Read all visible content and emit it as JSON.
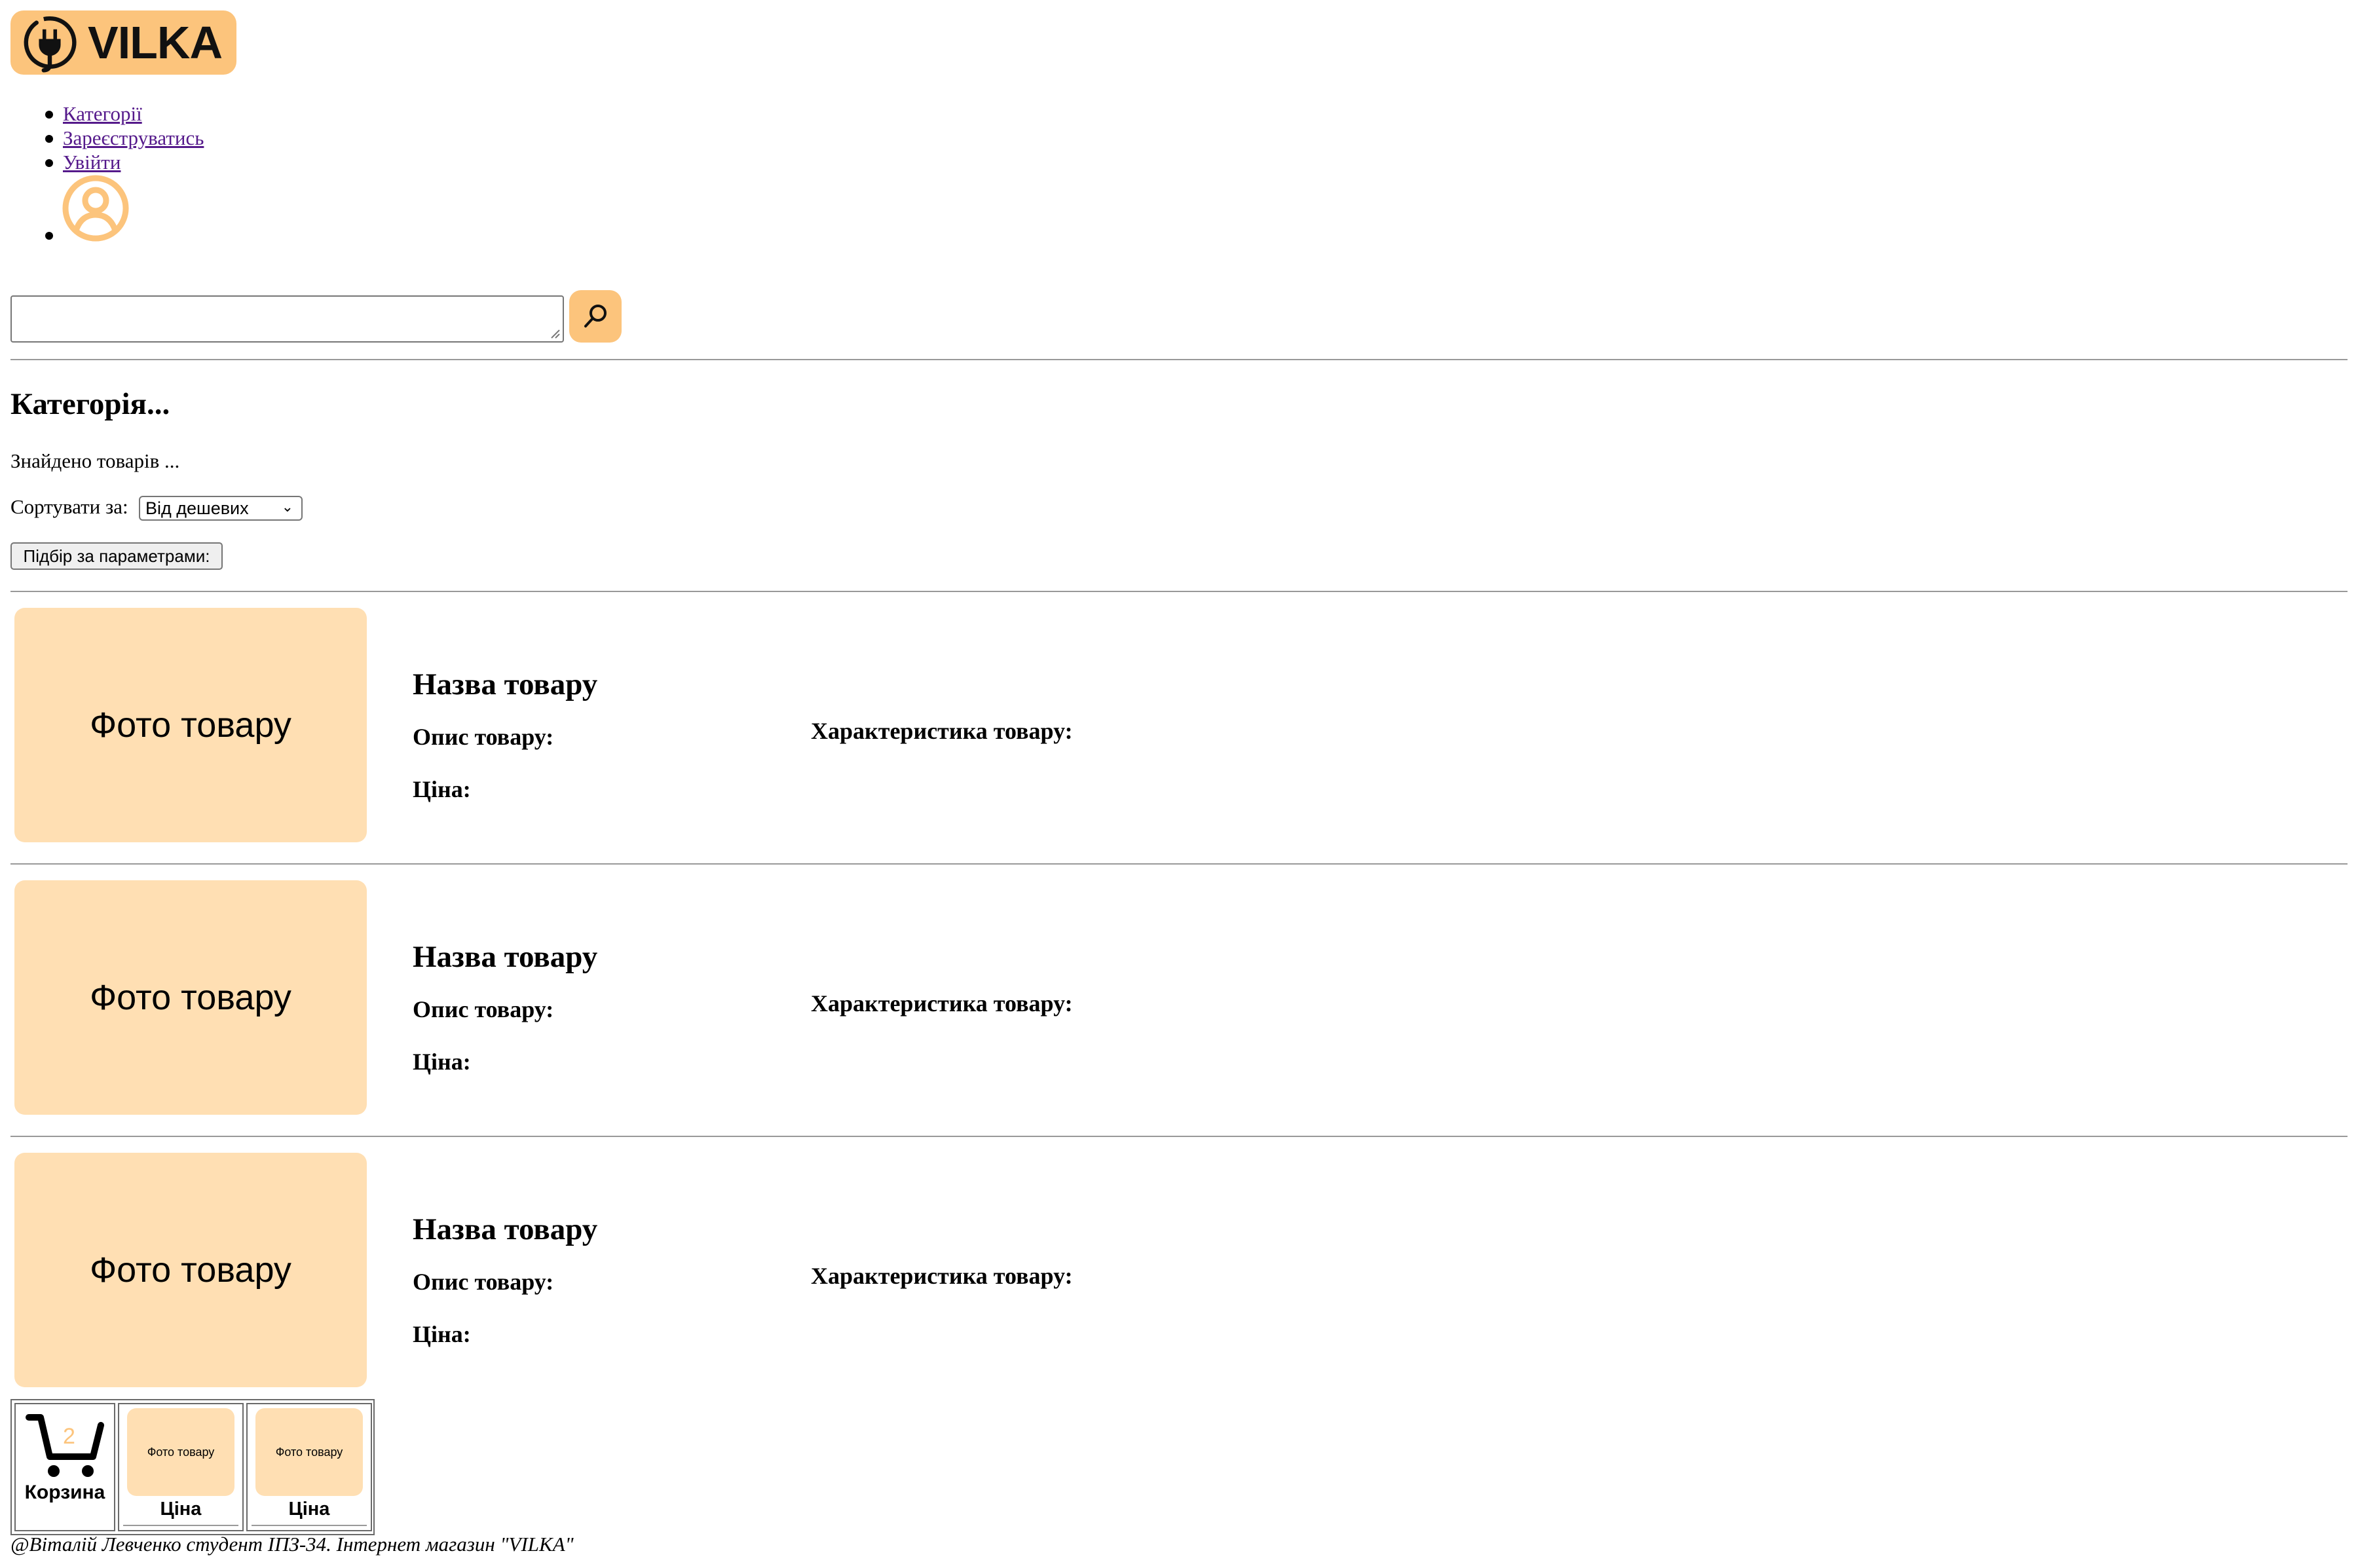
{
  "logo": {
    "text": "VILKA",
    "icon": "plug-icon"
  },
  "nav": {
    "items": [
      {
        "label": "Категорії"
      },
      {
        "label": "Зареєструватись"
      },
      {
        "label": "Увійти"
      }
    ],
    "account_icon": "user-circle-icon"
  },
  "search": {
    "value": "",
    "button_icon": "search-icon"
  },
  "category": {
    "title": "Категорія...",
    "found_text": "Знайдено товарів ...",
    "sort_label": "Сортувати за:",
    "sort_selected": "Від дешевих",
    "filter_button": "Підбір за параметрами:"
  },
  "products": [
    {
      "photo": "Фото товару",
      "name": "Назва товару",
      "desc_label": "Опис товару:",
      "spec_label": "Характеристика товару:",
      "price_label": "Ціна:"
    },
    {
      "photo": "Фото товару",
      "name": "Назва товару",
      "desc_label": "Опис товару:",
      "spec_label": "Характеристика товару:",
      "price_label": "Ціна:"
    },
    {
      "photo": "Фото товару",
      "name": "Назва товару",
      "desc_label": "Опис товару:",
      "spec_label": "Характеристика товару:",
      "price_label": "Ціна:"
    }
  ],
  "cart": {
    "label": "Корзина",
    "count": "2",
    "icon": "cart-icon",
    "items": [
      {
        "photo": "Фото товару",
        "price": "Ціна"
      },
      {
        "photo": "Фото товару",
        "price": "Ціна"
      }
    ]
  },
  "footer": {
    "text": "@Віталій Левченко студент ІПЗ-34. Інтернет магазин \"VILKA\""
  },
  "colors": {
    "accent": "#FCC47C",
    "photo_bg": "#FFDFB3",
    "link": "#551A8B"
  }
}
